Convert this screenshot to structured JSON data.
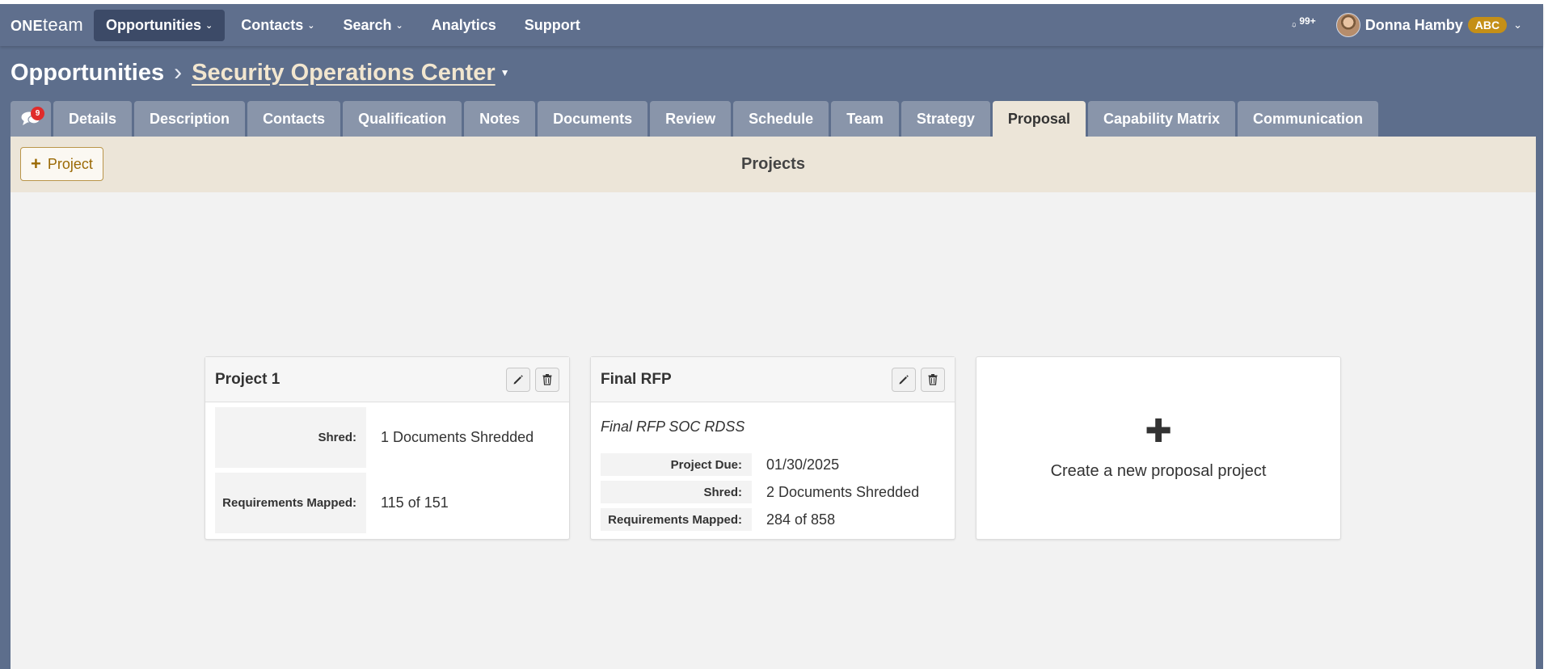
{
  "app": {
    "logo_bold": "ONE",
    "logo_light": "team"
  },
  "nav": {
    "items": [
      {
        "label": "Opportunities",
        "dropdown": true,
        "active": true
      },
      {
        "label": "Contacts",
        "dropdown": true,
        "active": false
      },
      {
        "label": "Search",
        "dropdown": true,
        "active": false
      },
      {
        "label": "Analytics",
        "dropdown": false,
        "active": false
      },
      {
        "label": "Support",
        "dropdown": false,
        "active": false
      }
    ],
    "notifications_count": "99+",
    "user_name": "Donna Hamby",
    "user_badge": "ABC"
  },
  "breadcrumb": {
    "root": "Opportunities",
    "current": "Security Operations Center"
  },
  "tabs": {
    "chat_badge": "9",
    "items": [
      "Details",
      "Description",
      "Contacts",
      "Qualification",
      "Notes",
      "Documents",
      "Review",
      "Schedule",
      "Team",
      "Strategy",
      "Proposal",
      "Capability Matrix",
      "Communication"
    ],
    "active": "Proposal"
  },
  "panel": {
    "add_button_label": "Project",
    "title": "Projects"
  },
  "projects": [
    {
      "title": "Project 1",
      "fields": [
        {
          "label": "Shred:",
          "value": "1 Documents Shredded"
        },
        {
          "label": "Requirements Mapped:",
          "value": "115 of 151"
        }
      ]
    },
    {
      "title": "Final RFP",
      "subtitle": "Final RFP SOC RDSS",
      "fields": [
        {
          "label": "Project Due:",
          "value": "01/30/2025"
        },
        {
          "label": "Shred:",
          "value": "2 Documents Shredded"
        },
        {
          "label": "Requirements Mapped:",
          "value": "284 of 858"
        }
      ]
    }
  ],
  "new_project": {
    "label": "Create a new proposal project"
  },
  "colors": {
    "nav_bg": "#5f6f8d",
    "active_nav": "#3c4a67",
    "tab_bg": "#8995aa",
    "active_tab": "#ece5d8",
    "accent": "#c48f17"
  }
}
